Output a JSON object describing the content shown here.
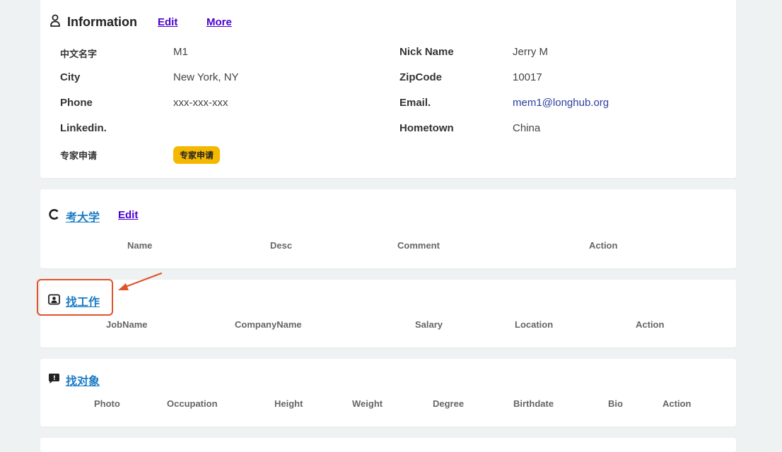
{
  "info": {
    "title": "Information",
    "edit_label": "Edit",
    "more_label": "More",
    "fields": {
      "chinese_name_label": "中文名字",
      "chinese_name_value": "M1",
      "nick_name_label": "Nick Name",
      "nick_name_value": "Jerry M",
      "city_label": "City",
      "city_value": "New York, NY",
      "zipcode_label": "ZipCode",
      "zipcode_value": "10017",
      "phone_label": "Phone",
      "phone_value": "xxx-xxx-xxx",
      "email_label": "Email.",
      "email_value": "mem1@longhub.org",
      "linkedin_label": "Linkedin.",
      "hometown_label": "Hometown",
      "hometown_value": "China",
      "expert_label": "专家申请",
      "expert_badge": "专家申请"
    }
  },
  "university": {
    "title": "考大学",
    "edit_label": "Edit",
    "columns": [
      "Name",
      "Desc",
      "Comment",
      "Action"
    ]
  },
  "jobs": {
    "title": "找工作",
    "columns": [
      "JobName",
      "CompanyName",
      "Salary",
      "Location",
      "Action"
    ]
  },
  "dating": {
    "title": "找对象",
    "columns": [
      "Photo",
      "Occupation",
      "Height",
      "Weight",
      "Degree",
      "Birthdate",
      "Bio",
      "Action"
    ]
  },
  "colors": {
    "accent_link": "#4b00d1",
    "section_link": "#1a7bc4",
    "badge": "#f5b800",
    "highlight": "#e0532b"
  }
}
